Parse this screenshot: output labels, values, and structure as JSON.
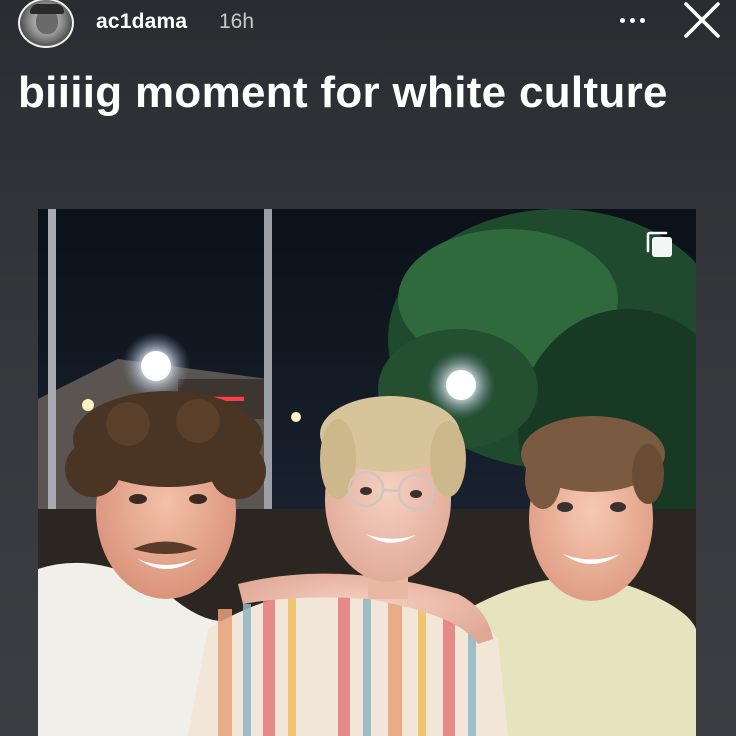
{
  "header": {
    "username": "ac1dama",
    "time": "16h"
  },
  "post": {
    "caption": "biiiig moment for white culture"
  },
  "icons": {
    "avatar": "profile-avatar",
    "more": "more-options-icon",
    "close": "close-icon",
    "carousel": "multiple-photos-icon"
  },
  "colors": {
    "background": "#2f3136",
    "text": "#ffffff",
    "secondary_text": "#c9c9c9"
  }
}
